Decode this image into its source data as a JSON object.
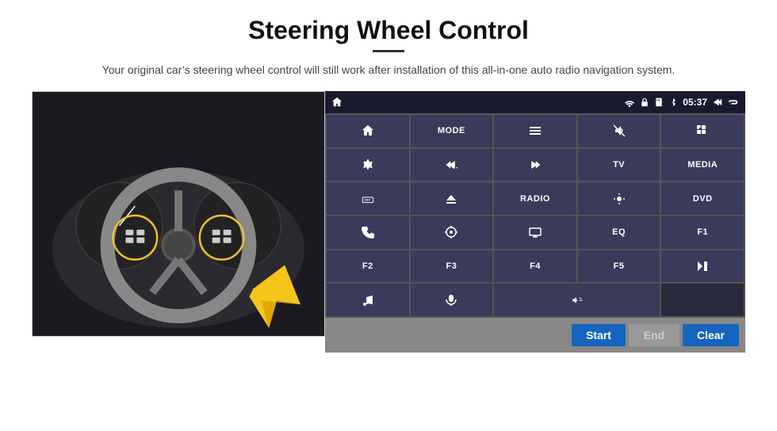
{
  "header": {
    "title": "Steering Wheel Control",
    "subtitle": "Your original car’s steering wheel control will still work after installation of this all-in-one auto radio navigation system."
  },
  "statusBar": {
    "time": "05:37"
  },
  "buttonGrid": [
    {
      "id": "btn-home",
      "type": "icon",
      "icon": "home"
    },
    {
      "id": "btn-mode",
      "type": "text",
      "label": "MODE"
    },
    {
      "id": "btn-menu",
      "type": "icon",
      "icon": "menu"
    },
    {
      "id": "btn-mute",
      "type": "icon",
      "icon": "mute"
    },
    {
      "id": "btn-apps",
      "type": "icon",
      "icon": "apps"
    },
    {
      "id": "btn-settings",
      "type": "icon",
      "icon": "settings"
    },
    {
      "id": "btn-prev",
      "type": "icon",
      "icon": "prev"
    },
    {
      "id": "btn-next",
      "type": "icon",
      "icon": "next"
    },
    {
      "id": "btn-tv",
      "type": "text",
      "label": "TV"
    },
    {
      "id": "btn-media",
      "type": "text",
      "label": "MEDIA"
    },
    {
      "id": "btn-360",
      "type": "icon",
      "icon": "360"
    },
    {
      "id": "btn-eject",
      "type": "icon",
      "icon": "eject"
    },
    {
      "id": "btn-radio",
      "type": "text",
      "label": "RADIO"
    },
    {
      "id": "btn-brightness",
      "type": "icon",
      "icon": "brightness"
    },
    {
      "id": "btn-dvd",
      "type": "text",
      "label": "DVD"
    },
    {
      "id": "btn-phone",
      "type": "icon",
      "icon": "phone"
    },
    {
      "id": "btn-gps",
      "type": "icon",
      "icon": "gps"
    },
    {
      "id": "btn-screen",
      "type": "icon",
      "icon": "screen"
    },
    {
      "id": "btn-eq",
      "type": "text",
      "label": "EQ"
    },
    {
      "id": "btn-f1",
      "type": "text",
      "label": "F1"
    },
    {
      "id": "btn-f2",
      "type": "text",
      "label": "F2"
    },
    {
      "id": "btn-f3",
      "type": "text",
      "label": "F3"
    },
    {
      "id": "btn-f4",
      "type": "text",
      "label": "F4"
    },
    {
      "id": "btn-f5",
      "type": "text",
      "label": "F5"
    },
    {
      "id": "btn-playpause",
      "type": "icon",
      "icon": "playpause"
    },
    {
      "id": "btn-music",
      "type": "icon",
      "icon": "music"
    },
    {
      "id": "btn-mic",
      "type": "icon",
      "icon": "mic"
    },
    {
      "id": "btn-vol",
      "type": "icon",
      "icon": "vol"
    },
    {
      "id": "btn-empty1",
      "type": "empty",
      "label": ""
    },
    {
      "id": "btn-empty2",
      "type": "empty",
      "label": ""
    }
  ],
  "actionButtons": {
    "start": "Start",
    "end": "End",
    "clear": "Clear"
  }
}
